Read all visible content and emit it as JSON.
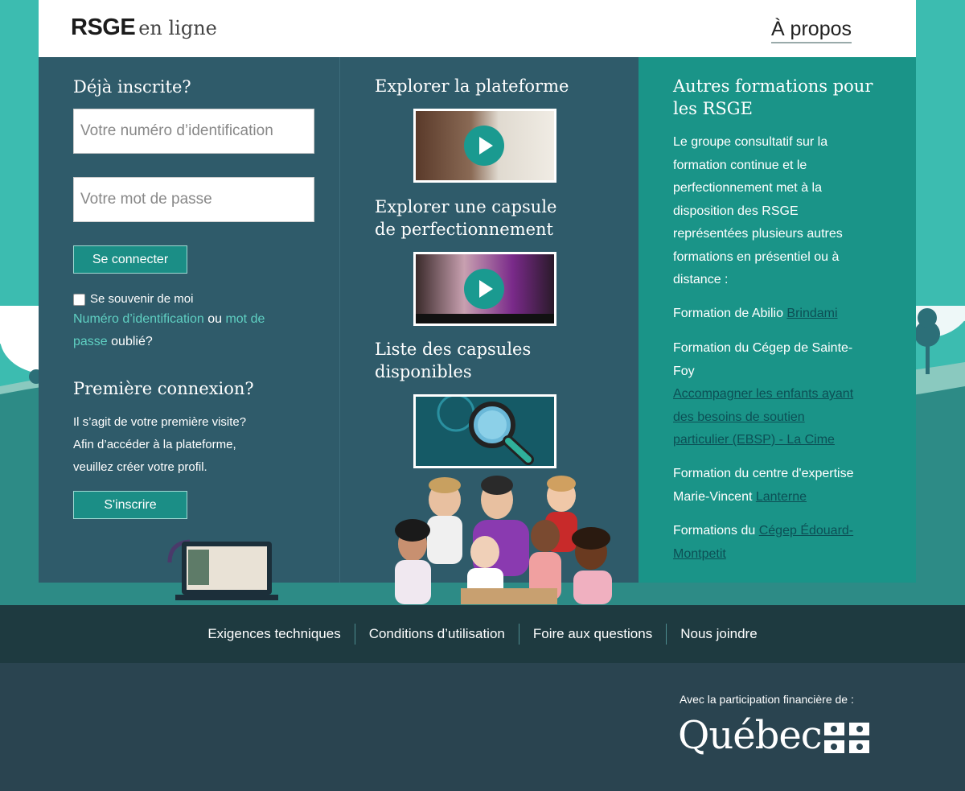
{
  "header": {
    "logo_bold": "RSGE",
    "logo_light": "en ligne",
    "about_link": "À propos"
  },
  "login": {
    "title": "Déjà inscrite?",
    "id_placeholder": "Votre numéro d’identification",
    "password_placeholder": "Votre mot de passe",
    "connect_button": "Se connecter",
    "remember_label": "Se souvenir de moi",
    "forgot_id_link": "Numéro d’identification",
    "forgot_or": "ou",
    "forgot_pwd_link_1": "mot de",
    "forgot_pwd_link_2": "passe",
    "forgot_suffix": "oublié?"
  },
  "first_login": {
    "title": "Première connexion?",
    "line1": "Il s’agit de votre première visite?",
    "line2": "Afin d’accéder à la plateforme,",
    "line3": "veuillez créer votre profil.",
    "signup_button": "S'inscrire"
  },
  "explore": {
    "platform_title": "Explorer la plateforme",
    "capsule_title_1": "Explorer une capsule",
    "capsule_title_2": "de perfectionnement",
    "list_title_1": "Liste des capsules",
    "list_title_2": "disponibles"
  },
  "other_trainings": {
    "title_1": "Autres formations pour",
    "title_2": "les RSGE",
    "intro": [
      "Le groupe consultatif sur la",
      "formation continue et le",
      "perfectionnement met à la",
      "disposition des RSGE",
      "représentées plusieurs autres",
      "formations en présentiel ou à",
      "distance :"
    ],
    "item1_prefix": "Formation de Abilio ",
    "item1_link": "Brindami",
    "item2_line1": "Formation du Cégep de Sainte-",
    "item2_line2": "Foy",
    "item2_link": [
      "Accompagner les enfants ayant",
      "des besoins de soutien",
      "particulier (EBSP) - La Cime"
    ],
    "item3_line1": "Formation du centre d'expertise",
    "item3_prefix": "Marie-Vincent ",
    "item3_link": "Lanterne",
    "item4_prefix": "Formations du ",
    "item4_link_1": "Cégep Édouard-",
    "item4_link_2": "Montpetit"
  },
  "footer": {
    "links": [
      "Exigences techniques",
      "Conditions d’utilisation",
      "Foire aux questions",
      "Nous joindre"
    ],
    "sponsor_text": "Avec la participation financière de :",
    "quebec_logo": "Québec"
  },
  "colors": {
    "teal_background": "#3cbcb0",
    "panel_dark": "#2f5b6a",
    "panel_teal": "#1a9488",
    "footer_dark": "#1e3a40",
    "footer_bottom": "#2a4450"
  }
}
